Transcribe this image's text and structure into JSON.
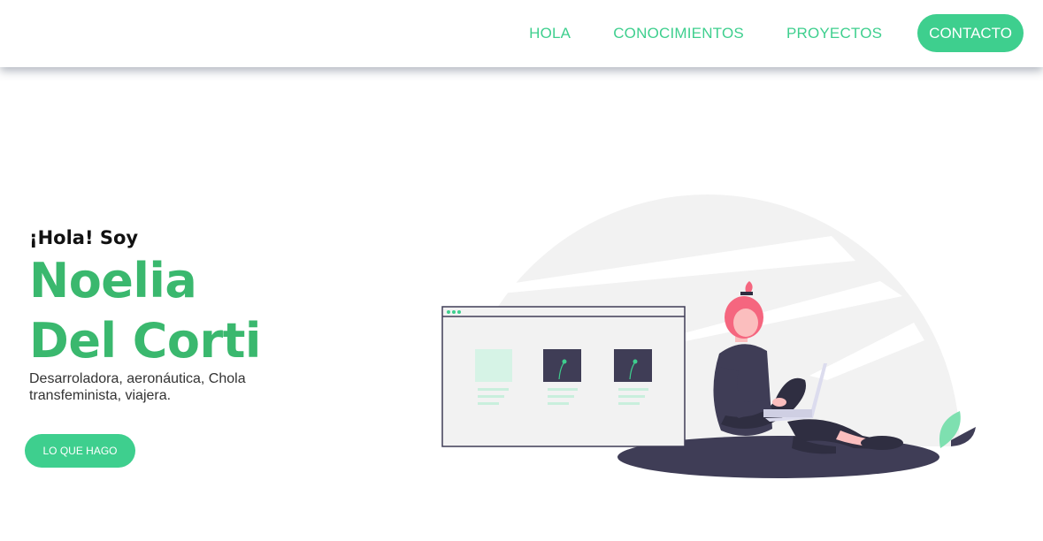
{
  "nav": {
    "items": [
      {
        "label": "HOLA"
      },
      {
        "label": "CONOCIMIENTOS"
      },
      {
        "label": "PROYECTOS"
      }
    ],
    "contact_label": "CONTACTO"
  },
  "hero": {
    "greeting": "¡Hola! Soy",
    "name_line1": "Noelia",
    "name_line2": "Del Corti",
    "subtitle_line1": "Desarroladora, aeronáutica, Chola",
    "subtitle_line2": "transfeminista, viajera.",
    "cta_label": "LO QUE HAGO"
  },
  "colors": {
    "accent": "#3ecf8e",
    "name_green": "#3ab86e",
    "illustration_dark": "#3f3d56",
    "hair_pink": "#f5667f"
  }
}
